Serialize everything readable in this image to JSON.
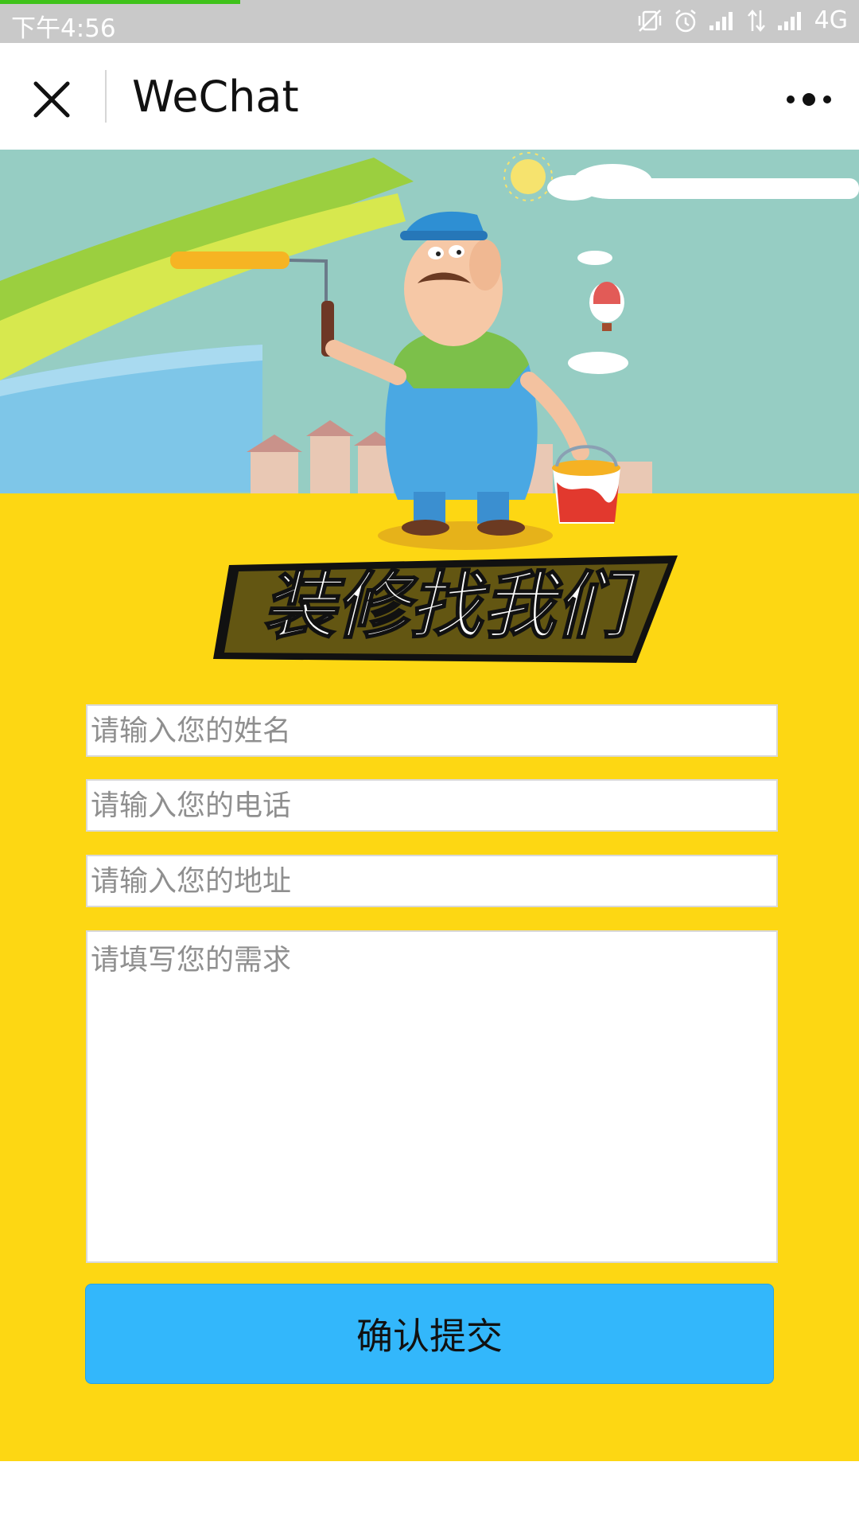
{
  "status_bar": {
    "time": "下午4:56",
    "network": "4G",
    "icons": [
      "vibrate-off-icon",
      "alarm-icon",
      "signal-icon",
      "data-arrows-icon",
      "signal-icon"
    ],
    "page_load_progress": 0.28
  },
  "nav": {
    "title": "WeChat",
    "close_icon": "close-icon",
    "more_icon": "more-icon"
  },
  "banner": {
    "slogan": "装修找我们"
  },
  "form": {
    "name_placeholder": "请输入您的姓名",
    "phone_placeholder": "请输入您的电话",
    "address_placeholder": "请输入您的地址",
    "needs_placeholder": "请填写您的需求",
    "submit_label": "确认提交"
  },
  "colors": {
    "brand_yellow": "#fdd713",
    "submit_blue": "#33b7fb",
    "status_bar_gray": "#c9c9c9",
    "progress_green": "#3fc21a"
  }
}
